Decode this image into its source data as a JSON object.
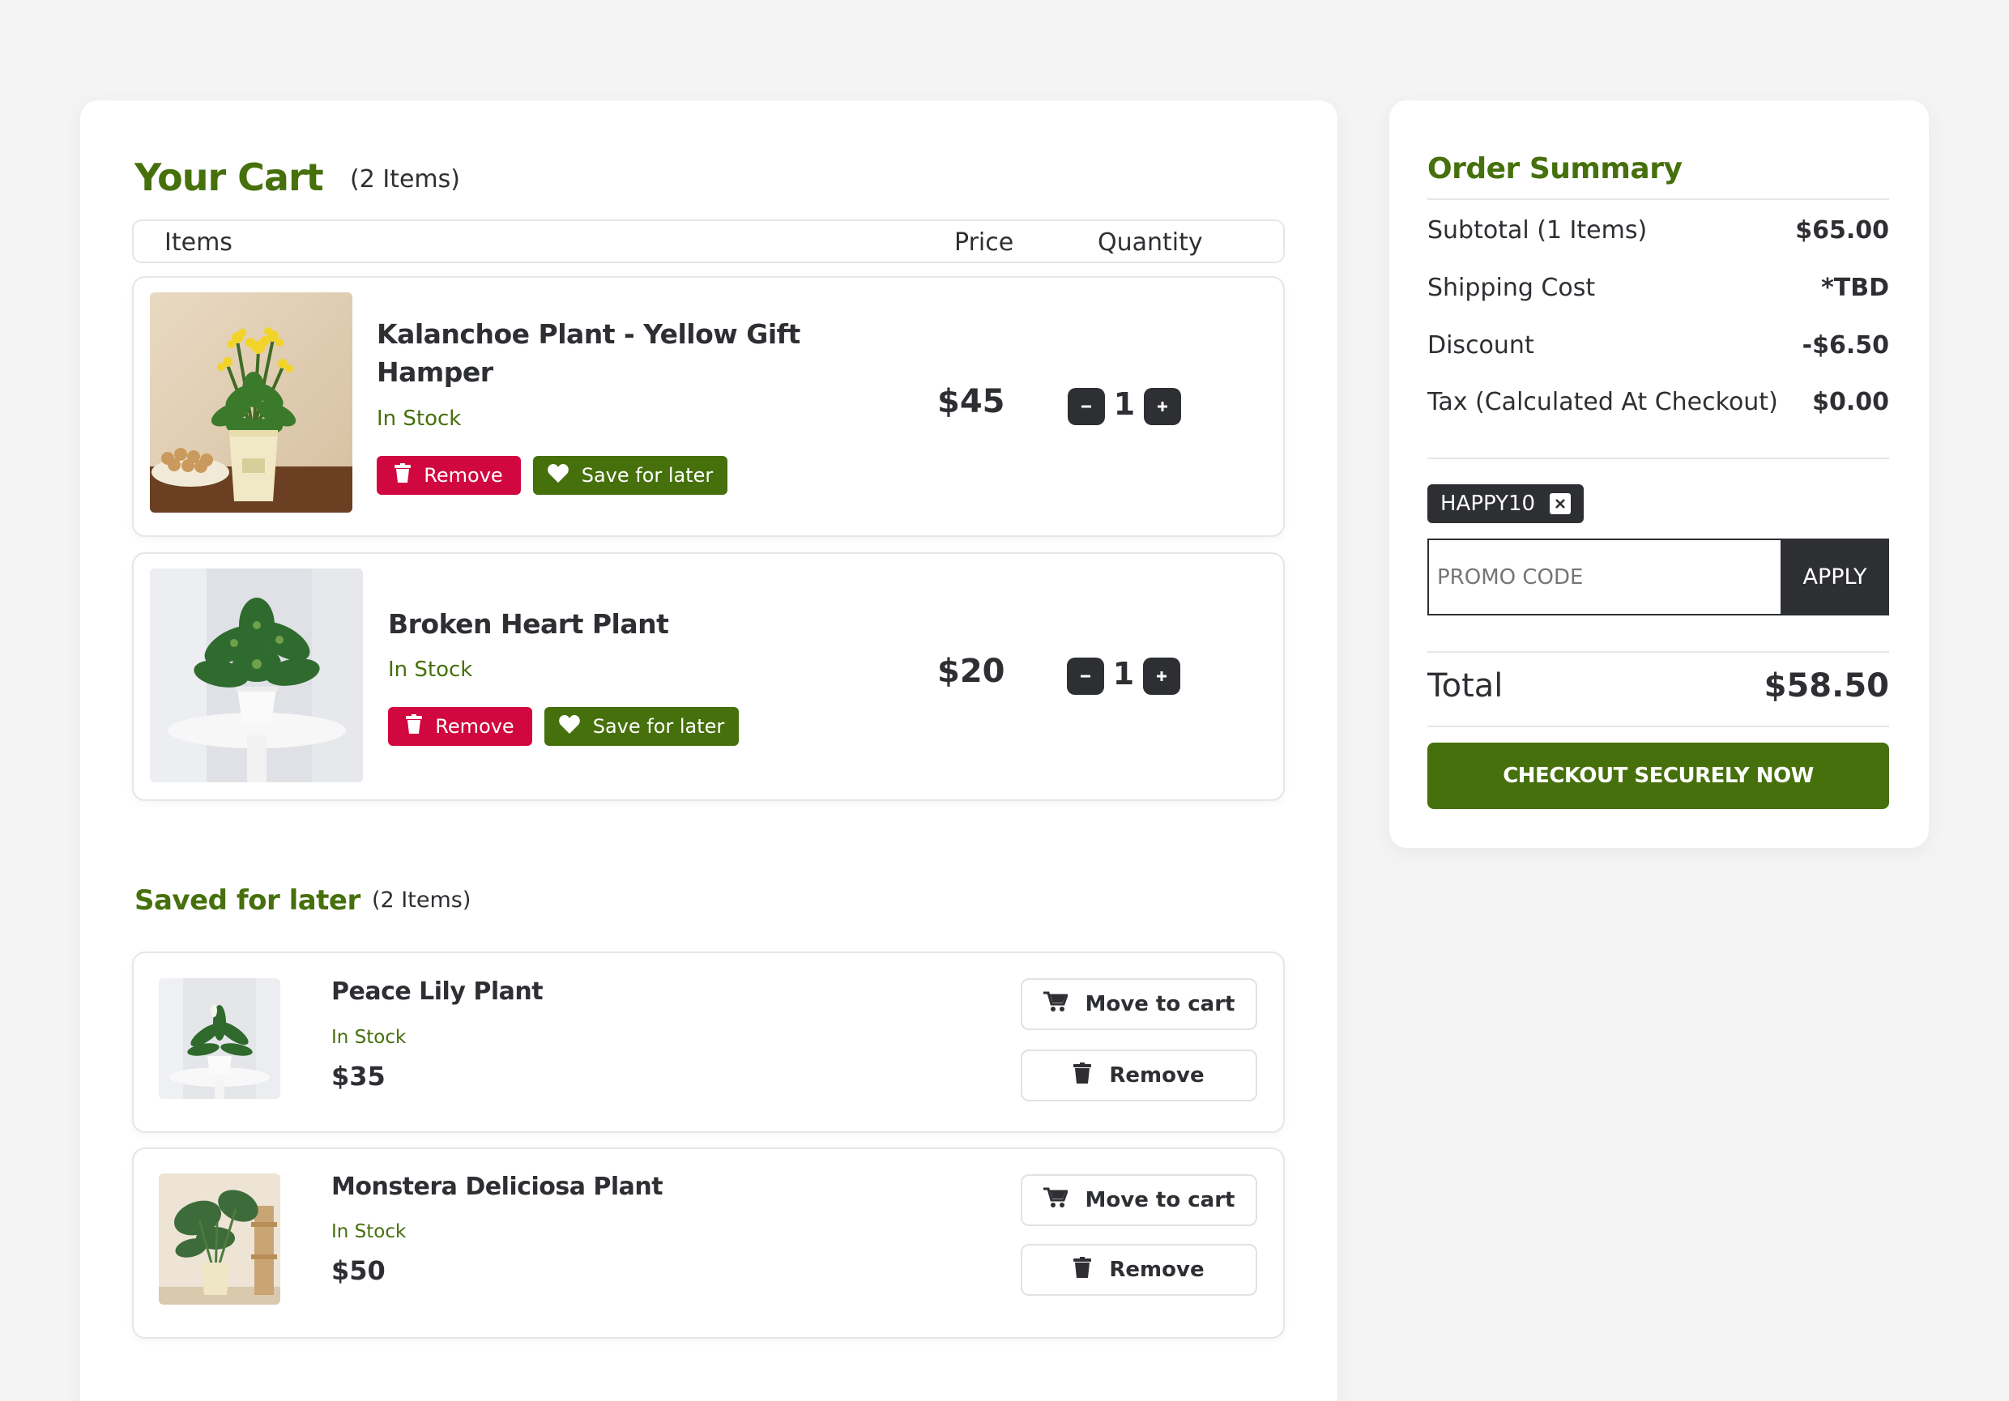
{
  "cart": {
    "title": "Your Cart",
    "count": "(2 Items)",
    "columns": {
      "items": "Items",
      "price": "Price",
      "quantity": "Quantity"
    },
    "items": [
      {
        "name_line1": "Kalanchoe Plant - Yellow Gift",
        "name_line2": "Hamper",
        "stock": "In Stock",
        "price": "$45",
        "qty": "1",
        "remove": "Remove",
        "save": "Save for later"
      },
      {
        "name_line1": "Broken Heart Plant",
        "stock": "In Stock",
        "price": "$20",
        "qty": "1",
        "remove": "Remove",
        "save": "Save for later"
      }
    ]
  },
  "saved": {
    "title": "Saved for later",
    "count": "(2 Items)",
    "items": [
      {
        "name": "Peace Lily Plant",
        "stock": "In Stock",
        "price": "$35",
        "move": "Move to cart",
        "remove": "Remove"
      },
      {
        "name": "Monstera Deliciosa Plant",
        "stock": "In Stock",
        "price": "$50",
        "move": "Move to cart",
        "remove": "Remove"
      }
    ]
  },
  "summary": {
    "title": "Order Summary",
    "rows": [
      {
        "label": "Subtotal (1 Items)",
        "value": "$65.00"
      },
      {
        "label": "Shipping Cost",
        "value": "*TBD"
      },
      {
        "label": "Discount",
        "value": "-$6.50"
      },
      {
        "label": "Tax (Calculated At Checkout)",
        "value": "$0.00"
      }
    ],
    "applied_code": "HAPPY10",
    "promo_placeholder": "PROMO CODE",
    "apply_label": "APPLY",
    "total_label": "Total",
    "total_value": "$58.50",
    "checkout_label": "CHECKOUT SECURELY NOW"
  },
  "colors": {
    "brand_green": "#46700c",
    "danger_red": "#d1073f",
    "dark": "#2d2f33"
  }
}
